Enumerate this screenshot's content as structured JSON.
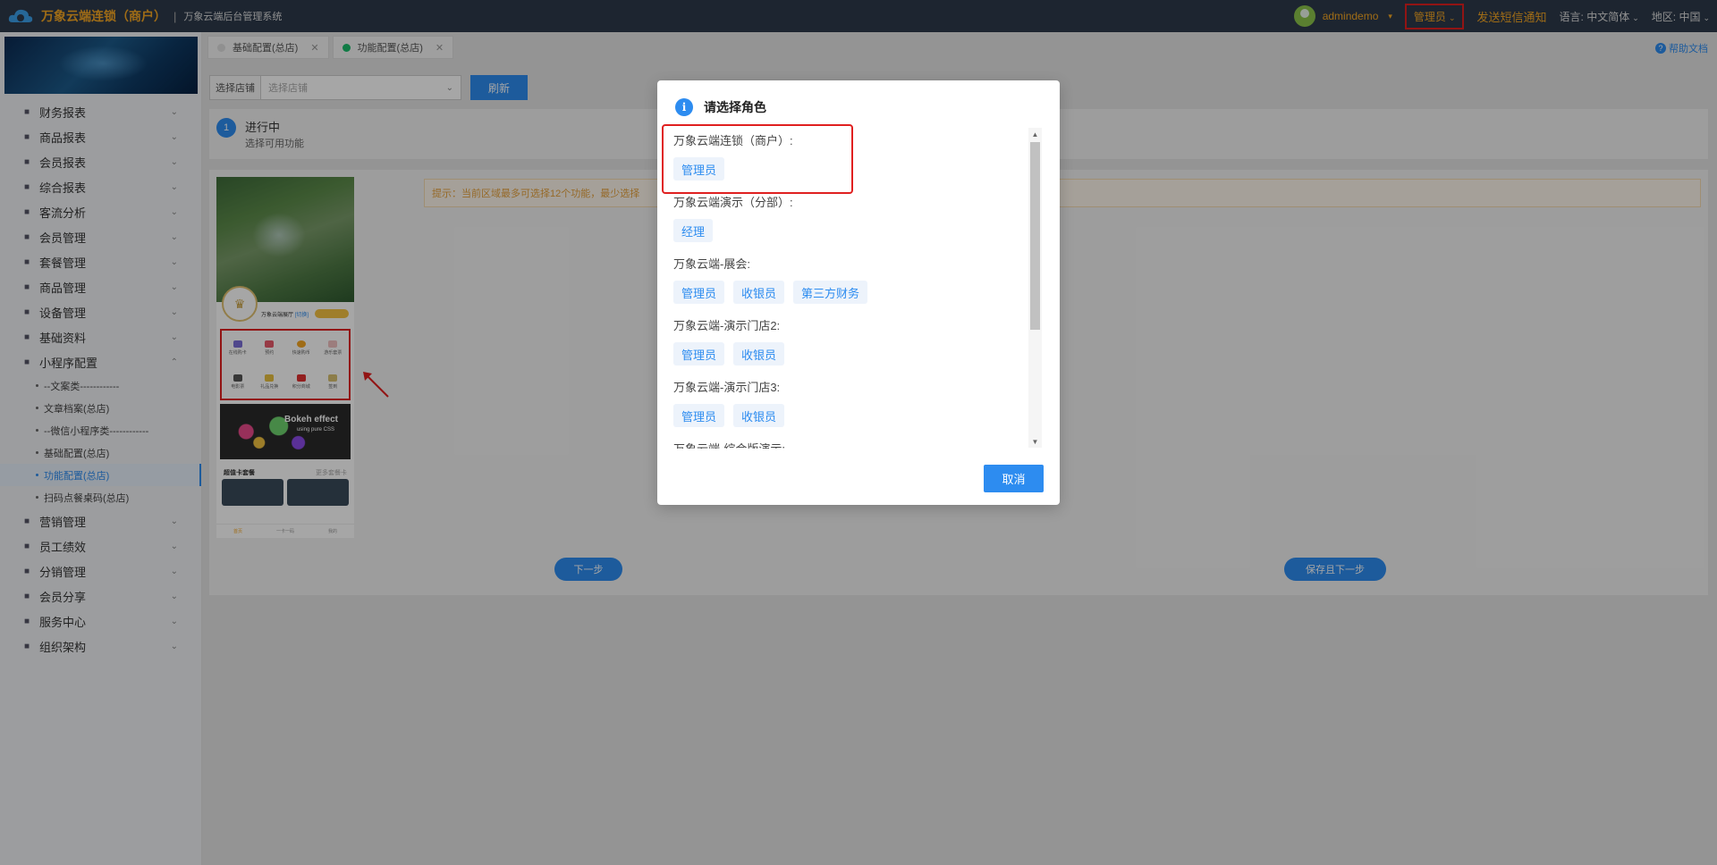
{
  "topbar": {
    "brand_name": "万象云端连锁（商户）",
    "separator": "|",
    "system_name": "万象云端后台管理系统",
    "username": "admindemo",
    "role": "管理员",
    "sms_notice": "发送短信通知",
    "language_label": "语言:",
    "language_value": "中文简体",
    "region_label": "地区:",
    "region_value": "中国"
  },
  "sidebar": {
    "items": [
      {
        "label": "财务报表",
        "icon": "finance-report-icon"
      },
      {
        "label": "商品报表",
        "icon": "goods-report-icon"
      },
      {
        "label": "会员报表",
        "icon": "member-report-icon"
      },
      {
        "label": "综合报表",
        "icon": "summary-report-icon"
      },
      {
        "label": "客流分析",
        "icon": "traffic-analysis-icon"
      },
      {
        "label": "会员管理",
        "icon": "member-icon"
      },
      {
        "label": "套餐管理",
        "icon": "package-icon"
      },
      {
        "label": "商品管理",
        "icon": "goods-icon"
      },
      {
        "label": "设备管理",
        "icon": "device-icon"
      },
      {
        "label": "基础资料",
        "icon": "document-icon"
      },
      {
        "label": "小程序配置",
        "icon": "gear-icon"
      }
    ],
    "sub_items": [
      "--文案类------------",
      "文章档案(总店)",
      "--微信小程序类------------",
      "基础配置(总店)",
      "功能配置(总店)",
      "扫码点餐桌码(总店)"
    ],
    "items_after": [
      {
        "label": "营销管理",
        "icon": "tag-icon"
      },
      {
        "label": "员工绩效",
        "icon": "performance-icon"
      },
      {
        "label": "分销管理",
        "icon": "distribution-icon"
      },
      {
        "label": "会员分享",
        "icon": "share-icon"
      },
      {
        "label": "服务中心",
        "icon": "service-icon"
      },
      {
        "label": "组织架构",
        "icon": "org-icon"
      }
    ]
  },
  "tabs": [
    {
      "label": "基础配置(总店)"
    },
    {
      "label": "功能配置(总店)"
    }
  ],
  "help_label": "帮助文档",
  "filter": {
    "label": "选择店铺",
    "placeholder": "选择店铺",
    "refresh": "刷新"
  },
  "steps": {
    "number": "1",
    "title": "进行中",
    "subtitle": "选择可用功能"
  },
  "notice": "提示：当前区域最多可选择12个功能，最少选择",
  "phone": {
    "store_name": "万象云端展厅",
    "store_tag": "[切换]",
    "grid_items": [
      "在线购卡",
      "预约",
      "快速购币",
      "游乐套票",
      "电影票",
      "礼品兑换",
      "积分商城",
      "签到"
    ],
    "bokeh_title": "Bokeh effect",
    "bokeh_sub": "using pure CSS",
    "cards_title": "超值卡套餐",
    "cards_more": "更多套餐卡",
    "tabbar": [
      "首页",
      "一卡一码",
      "我的"
    ]
  },
  "buttons": {
    "next": "下一步",
    "save_next": "保存且下一步"
  },
  "modal": {
    "title": "请选择角色",
    "groups": [
      {
        "label": "万象云端连锁（商户）:",
        "roles": [
          "管理员"
        ]
      },
      {
        "label": "万象云端演示（分部）:",
        "roles": [
          "经理"
        ]
      },
      {
        "label": "万象云端-展会:",
        "roles": [
          "管理员",
          "收银员",
          "第三方财务"
        ]
      },
      {
        "label": "万象云端-演示门店2:",
        "roles": [
          "管理员",
          "收银员"
        ]
      },
      {
        "label": "万象云端-演示门店3:",
        "roles": [
          "管理员",
          "收银员"
        ]
      },
      {
        "label": "万象云端-综合版演示:",
        "roles": []
      }
    ],
    "cancel": "取消"
  },
  "colors": {
    "primary": "#2d8cf0",
    "topbar": "#2d3a4b",
    "brand": "#f5a623",
    "highlight": "#e02020"
  }
}
